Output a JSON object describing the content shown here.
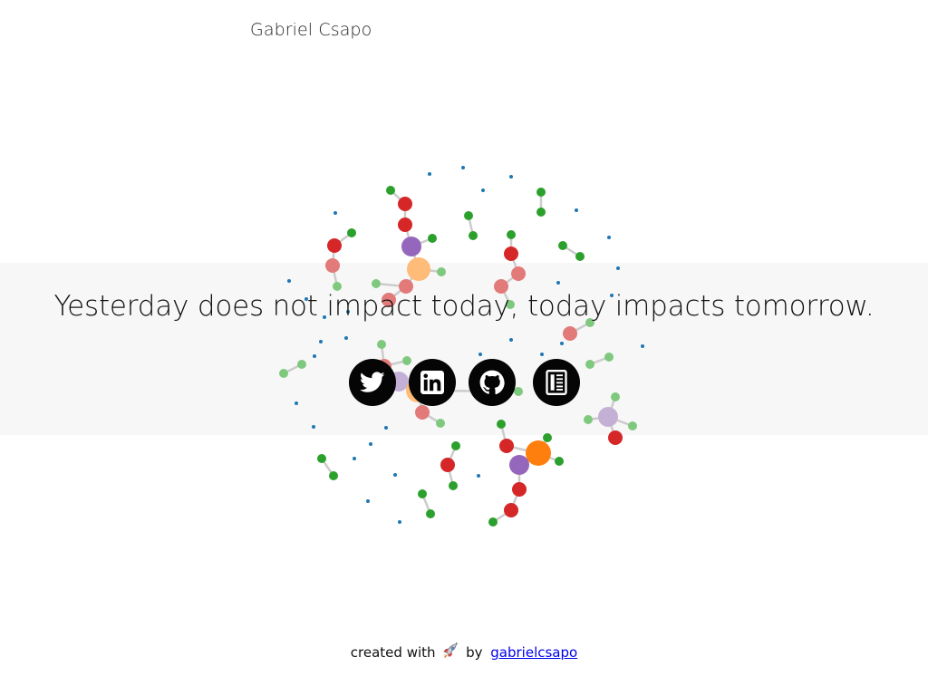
{
  "header": {
    "author_name": "Gabriel Csapo"
  },
  "hero": {
    "quote": "Yesterday does not impact today, today impacts tomorrow."
  },
  "social_links": [
    {
      "name": "twitter",
      "icon": "twitter-icon"
    },
    {
      "name": "linkedin",
      "icon": "linkedin-icon"
    },
    {
      "name": "github",
      "icon": "github-icon"
    },
    {
      "name": "blog",
      "icon": "newspaper-icon"
    }
  ],
  "footer": {
    "created_with": "created with",
    "rocket_icon": "rocket-icon",
    "by": "by",
    "link_text": "gabrielcsapo"
  },
  "colors": {
    "accent_green": "#2ca02c",
    "accent_red": "#d62728",
    "accent_purple": "#9467bd",
    "accent_orange": "#ff7f0e",
    "accent_blue": "#1f77b4",
    "link_color": "#0000ee",
    "icon_bg": "#050505"
  }
}
